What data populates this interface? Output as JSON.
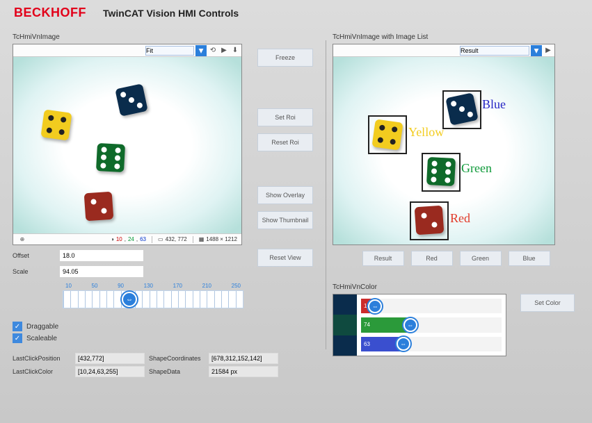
{
  "brand": "BECKHOFF",
  "title": "TwinCAT Vision HMI Controls",
  "left": {
    "section": "TcHmiVnImage",
    "fit_option": "Fit",
    "status": {
      "rgb": {
        "r": "10",
        "g": "24",
        "b": "63"
      },
      "coords": "432, 772",
      "dims": "1488 × 1212"
    },
    "offset_label": "Offset",
    "offset_value": "18.0",
    "scale_label": "Scale",
    "scale_value": "94.05",
    "ruler_ticks": [
      "10",
      "50",
      "90",
      "130",
      "170",
      "210",
      "250"
    ],
    "draggable_label": "Draggable",
    "scaleable_label": "Scaleable",
    "lastpos_label": "LastClickPosition",
    "lastpos_value": "[432,772]",
    "lastcolor_label": "LastClickColor",
    "lastcolor_value": "[10,24,63,255]",
    "shapecoord_label": "ShapeCoordinates",
    "shapecoord_value": "[678,312,152,142]",
    "shapedata_label": "ShapeData",
    "shapedata_value": "21584 px"
  },
  "mid": {
    "freeze": "Freeze",
    "setroi": "Set Roi",
    "resetroi": "Reset Roi",
    "showoverlay": "Show Overlay",
    "showthumb": "Show Thumbnail",
    "resetview": "Reset View"
  },
  "right": {
    "section": "TcHmiVnImage with Image List",
    "result_option": "Result",
    "labels": {
      "blue": "Blue",
      "yellow": "Yellow",
      "green": "Green",
      "red": "Red"
    },
    "buttons": [
      "Result",
      "Red",
      "Green",
      "Blue"
    ]
  },
  "color": {
    "section": "TcHmiVnColor",
    "r": "10",
    "g": "74",
    "b": "63",
    "setcolor": "Set Color"
  }
}
